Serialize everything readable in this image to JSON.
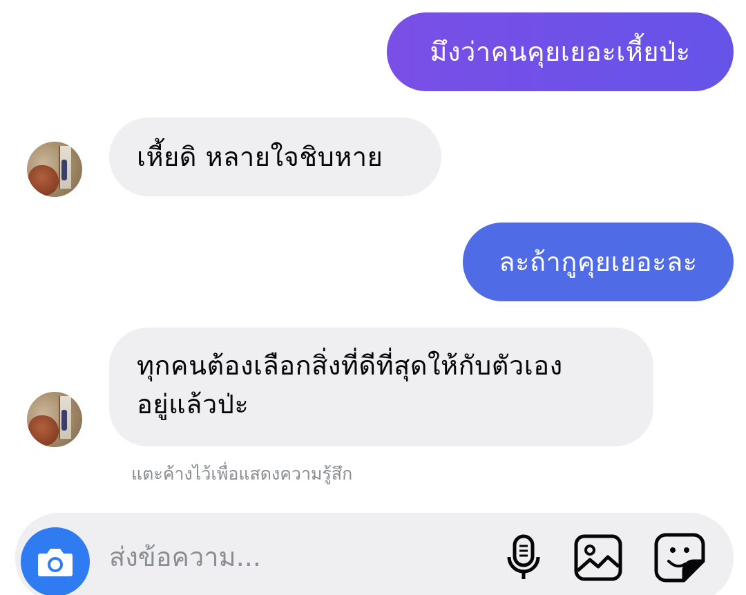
{
  "messages": [
    {
      "direction": "outgoing",
      "text": "มึงว่าคนคุยเยอะเหี้ยป่ะ"
    },
    {
      "direction": "incoming",
      "text": "เหี้ยดิ หลายใจชิบหาย"
    },
    {
      "direction": "outgoing",
      "text": "ละถ้ากูคุยเยอะละ"
    },
    {
      "direction": "incoming",
      "lines": [
        "ทุกคนต้องเลือกสิ่งที่ดีที่สุดให้กับตัวเอง",
        "อยู่แล้วป่ะ"
      ]
    }
  ],
  "reaction_hint": "แตะค้างไว้เพื่อแสดงความรู้สึก",
  "composer": {
    "placeholder": "ส่งข้อความ...",
    "icons": [
      "camera-icon",
      "microphone-icon",
      "gallery-icon",
      "sticker-icon"
    ]
  },
  "colors": {
    "outgoing_bubble_1": "#7052e7",
    "outgoing_bubble_2": "#4f6be6",
    "incoming_bubble": "#efeff1",
    "camera_button": "#2f7cf2",
    "hint_text": "#8a8d91"
  }
}
